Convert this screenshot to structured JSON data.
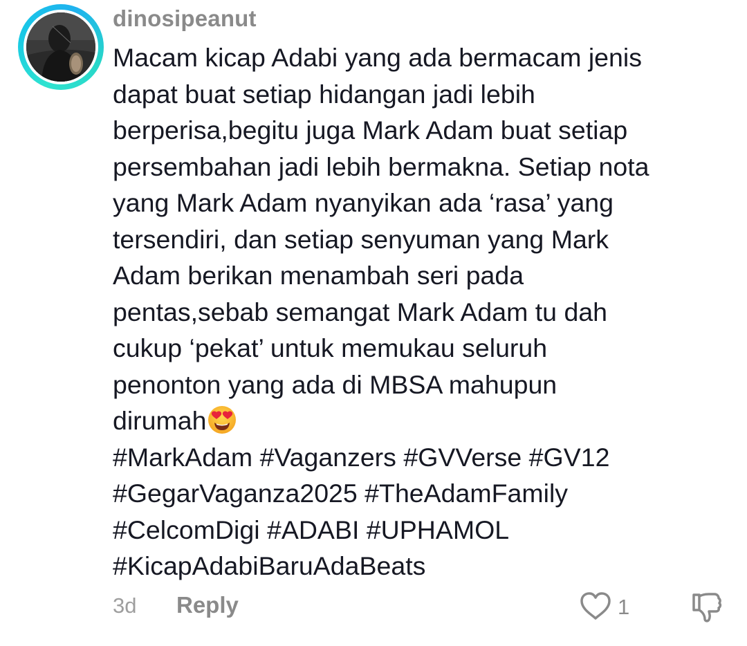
{
  "comment": {
    "username": "dinosipeanut",
    "lines": [
      "Macam kicap Adabi yang ada bermacam jenis",
      "dapat buat setiap hidangan jadi lebih",
      "berperisa,begitu juga Mark Adam buat setiap",
      "persembahan jadi lebih bermakna. Setiap nota",
      "yang Mark Adam nyanyikan ada ‘rasa’ yang",
      "tersendiri, dan setiap senyuman yang Mark",
      "Adam berikan menambah seri pada",
      "pentas,sebab semangat Mark Adam tu dah",
      "cukup ‘pekat’ untuk memukau seluruh",
      "penonton yang ada di MBSA mahupun",
      "dirumah"
    ],
    "hashtags": [
      "#MarkAdam #Vaganzers #GVVerse #GV12",
      "#GegarVaganza2025 #TheAdamFamily",
      "#CelcomDigi #ADABI #UPHAMOL",
      "#KicapAdabiBaruAdaBeats"
    ],
    "emoji": "smiling-face-with-heart-eyes-icon",
    "time_ago": "3d",
    "reply_label": "Reply",
    "like_count": "1"
  },
  "colors": {
    "text": "#161823",
    "muted": "#8a8a8a",
    "ring": "#1fc9e0"
  }
}
